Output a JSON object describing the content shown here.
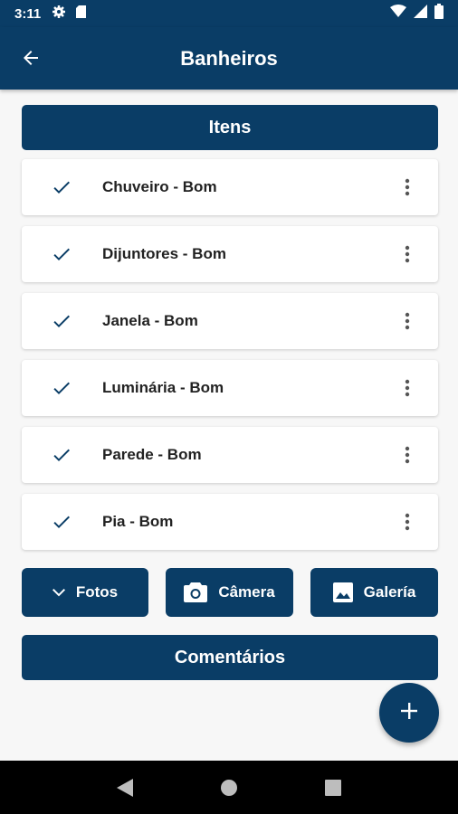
{
  "status_bar": {
    "time": "3:11",
    "icons": [
      "settings-icon",
      "sd-card-icon",
      "wifi-icon",
      "signal-icon",
      "battery-icon"
    ]
  },
  "app_bar": {
    "title": "Banheiros",
    "back_icon": "arrow-back-icon"
  },
  "items_section": {
    "header": "Itens",
    "items": [
      {
        "label": "Chuveiro - Bom",
        "icon": "check-icon"
      },
      {
        "label": "Dijuntores - Bom",
        "icon": "check-icon"
      },
      {
        "label": "Janela - Bom",
        "icon": "check-icon"
      },
      {
        "label": "Luminária - Bom",
        "icon": "check-icon"
      },
      {
        "label": "Parede - Bom",
        "icon": "check-icon"
      },
      {
        "label": "Pia - Bom",
        "icon": "check-icon"
      }
    ]
  },
  "actions": {
    "fotos_label": "Fotos",
    "camera_label": "Câmera",
    "galeria_label": "Galería"
  },
  "comments_section": {
    "header": "Comentários"
  },
  "fab": {
    "icon": "plus-icon"
  },
  "nav_bar": {
    "icons": [
      "back-triangle-icon",
      "home-circle-icon",
      "recents-square-icon"
    ]
  },
  "colors": {
    "primary": "#0a3d66",
    "background": "#f7f7f7",
    "card": "#ffffff",
    "text": "#222222"
  }
}
